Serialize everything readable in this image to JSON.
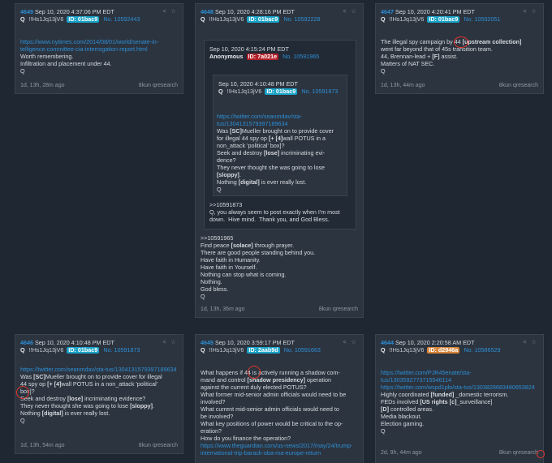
{
  "post4649": {
    "num": "4649",
    "date": "Sep 10, 2020 4:37:06 PM EDT",
    "name": "Q",
    "trip": "!!Hs1Jq13jV6",
    "id": "ID: 01bac9",
    "link": "No. 10592443",
    "body_link": "https://www.nytimes.com/2014/08/01/world/senate-in-telligence-committee-cia-interrogation-report.html",
    "body": "Worth remembering.\nInfiltration and placement under 44.\nQ",
    "age": "1d, 13h, 28m ago",
    "board": "8kun qresearch"
  },
  "post4648": {
    "num": "4648",
    "date": "Sep 10, 2020 4:28:16 PM EDT",
    "name": "Q",
    "trip": "!!Hs1Jq13jV6",
    "id": "ID: 01bac9",
    "link": "No. 10592228",
    "anon": {
      "date": "Sep 10, 2020 4:15:24 PM EDT",
      "name": "Anonymous",
      "id": "ID: 7a021e",
      "link": "No. 10591965",
      "quote": {
        "date": "Sep 10, 2020 4:10:48 PM EDT",
        "name": "Q",
        "trip": "!!Hs1Jq13jV6",
        "id": "ID: 01bac9",
        "link": "No. 10591873",
        "body_link": "https://twitter.com/seanmdav/sta-tus/1304131579397189634",
        "l1_pre": "Was ",
        "l1_b": "[SC]",
        "l1_post": "Mueller brought on to provide cover",
        "l2_pre": "for illegal 44 spy op ",
        "l2_b": "[+ [4]",
        "l2_post": "wall POTUS in a",
        "l3": "non_attack 'political' box]?",
        "l4_pre": "Seek and destroy ",
        "l4_b": "[lose]",
        "l4_post": " incriminating evi-",
        "l5": "dence?",
        "l6": "They never thought she was going to lose",
        "l7_b": "[sloppy]",
        "l7_post": ".",
        "l8_pre": "Nothing ",
        "l8_b": "[digital]",
        "l8_post": " is ever really lost.",
        "l9": "Q"
      },
      "reply": ">>10591873\nQ, you always seem to post exactly when I'm most\ndown.  Hive mind.  Thank you, and God Bless."
    },
    "b1": ">>10591965",
    "b2_pre": "Find peace ",
    "b2_b": "[solace]",
    "b2_post": " through prayer.",
    "b3": "There are good people standing behind you.\nHave faith in Humanity.\nHave faith in Yourself.\nNothing can stop what is coming.\nNothing.\nGod bless.\nQ",
    "age": "1d, 13h, 36m ago",
    "board": "8kun qresearch"
  },
  "post4647": {
    "num": "4647",
    "date": "Sep 10, 2020 4:20:41 PM EDT",
    "name": "Q",
    "trip": "!!Hs1Jq13jV6",
    "id": "ID: 01bac9",
    "link": "No. 10592051",
    "l1_pre": "The illegal spy campaign by 44 ",
    "l1_b": "[upstream collection]",
    "l2": "went far beyond that of 45s transition team.",
    "l3_pre": "44, Brennan-lead + ",
    "l3_b": "[F]",
    "l3_post": " assist.",
    "l4": "Matters of NAT SEC.\nQ",
    "age": "1d, 13h, 44m ago",
    "board": "8kun qresearch"
  },
  "post4646": {
    "num": "4646",
    "date": "Sep 10, 2020 4:10:48 PM EDT",
    "name": "Q",
    "trip": "!!Hs1Jq13jV6",
    "id": "ID: 01bac9",
    "link": "No. 10591873",
    "body_link": "https://twitter.com/seanmdav/sta-tus/1304131579397189634",
    "l1_pre": "Was ",
    "l1_b": "[SC]",
    "l1_post": "Mueller brought on to provide cover for illegal",
    "l2_pre": "44 spy op ",
    "l2_b": "[+ [4]",
    "l2_post": "wall POTUS in a non_attack 'political'",
    "l3": "box]?",
    "l4_pre": "Seek and destroy ",
    "l4_b": "[lose]",
    "l4_post": " incriminating evidence?",
    "l5_pre": "They never thought she was going to lose ",
    "l5_b": "[sloppy]",
    "l5_post": ".",
    "l6_pre": "Nothing ",
    "l6_b": "[digital]",
    "l6_post": " is ever really lost.",
    "l7": "Q",
    "age": "1d, 13h, 54m ago",
    "board": "8kun qresearch"
  },
  "post4645": {
    "num": "4645",
    "date": "Sep 10, 2020 3:59:17 PM EDT",
    "name": "Q",
    "trip": "!!Hs1Jq13jV6",
    "id": "ID: 2aab9d",
    "link": "No. 10591663",
    "l1": "What happens if 44 is actively running a shadow com-",
    "l2_pre": "mand and control ",
    "l2_b": "[shadow presidency]",
    "l2_post": " operation",
    "l3": "against the current duly elected POTUS?\nWhat former mid-senior admin officials would need to be\ninvolved?\nWhat current mid-senior admin officials would need to\nbe involved?\nWhat key positions of power would be critical to the op-\neration?\nHow do you finance the operation?",
    "body_link": "https://www.theguardian.com/us-news/2017/may/24/trump-international-trip-barack-oba-ma-europe-return"
  },
  "post4644": {
    "num": "4644",
    "date": "Sep 10, 2020 2:20:58 AM EDT",
    "name": "Q",
    "trip": "!!Hs1Jq13jV6",
    "id": "ID: d2946a",
    "link": "No. 10586529",
    "link1": "https://twitter.com/PJR45enate/sta-tus/1303592773715546114",
    "link2": "https://twitter.com/wspd1plo/sta-tus/1303828683480653824",
    "l1_pre": "Highly coordinated ",
    "l1_b": "[funded]",
    "l1_post": " _domestic terrorism.",
    "l2_pre": "FEDs involved ",
    "l2_b": "[US rights [c]",
    "l2_post": "_surveillance]",
    "l3_b": "[D]",
    "l3_post": " controlled areas.",
    "l4": "Media blackout.\nElection gaming.\nQ",
    "age": "2d, 9h, 44m ago",
    "board": "8kun qresearch"
  },
  "colors": {
    "id_blue": "#1aa3c8",
    "id_red": "#b3202a",
    "id_orange": "#d7843a",
    "link": "#2d8fd6"
  }
}
